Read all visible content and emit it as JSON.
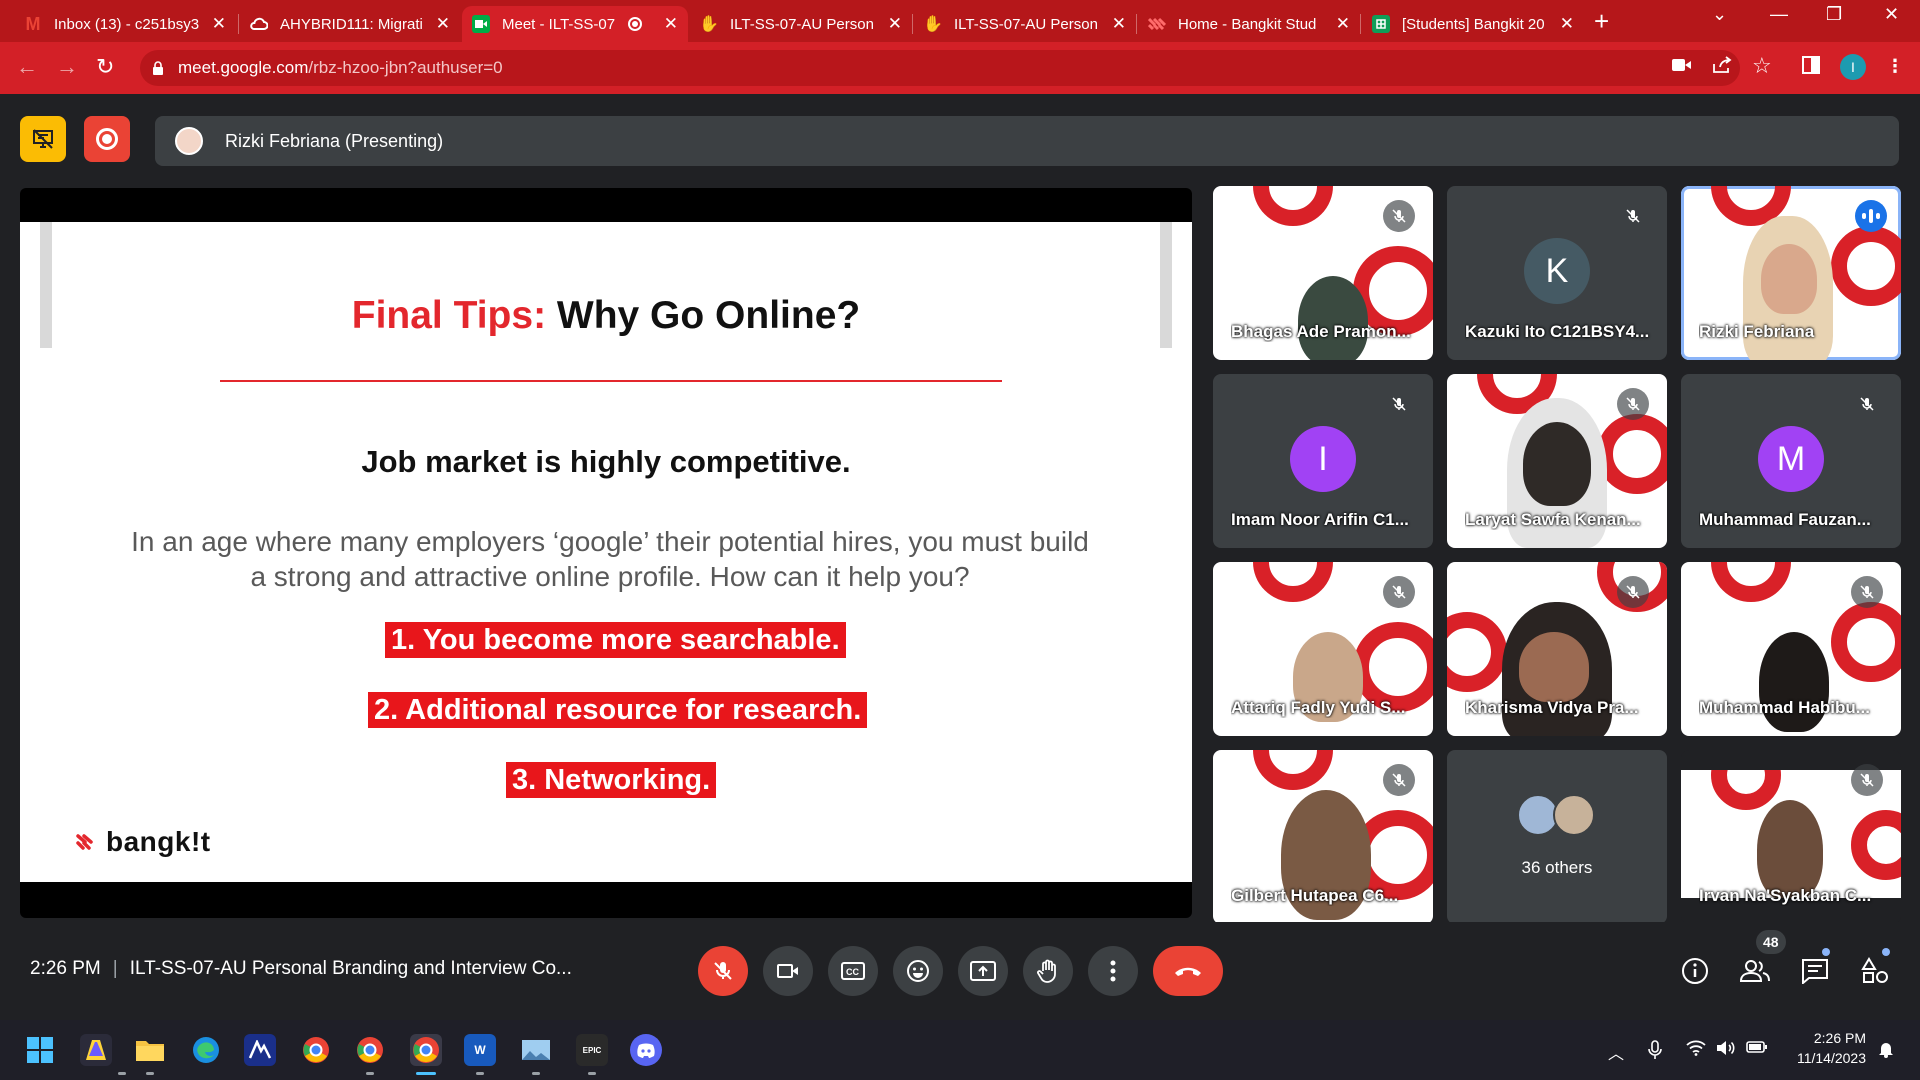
{
  "browser": {
    "tabs": [
      {
        "label": "Inbox (13) - c251bsy3",
        "icon": "gmail-icon",
        "color": "#ea4335"
      },
      {
        "label": "AHYBRID111: Migrati",
        "icon": "cloud-icon",
        "color": "#4285f4"
      },
      {
        "label": "Meet - ILT-SS-07",
        "icon": "meet-icon",
        "color": "#00ac47",
        "active": true
      },
      {
        "label": "ILT-SS-07-AU Person",
        "icon": "hand-icon",
        "color": "#fbbc04"
      },
      {
        "label": "ILT-SS-07-AU Person",
        "icon": "hand-icon",
        "color": "#fbbc04"
      },
      {
        "label": "Home - Bangkit Stud",
        "icon": "bangkit-icon",
        "color": "#d32027"
      },
      {
        "label": "[Students] Bangkit 20",
        "icon": "sheets-icon",
        "color": "#0f9d58"
      }
    ],
    "url_host": "meet.google.com",
    "url_path": "/rbz-hzoo-jbn?authuser=0",
    "profile_initial": "I"
  },
  "meeting": {
    "presenter_label": "Rizki Febriana (Presenting)",
    "time": "2:26 PM",
    "title": "ILT-SS-07-AU Personal Branding and Interview Co...",
    "participant_count": "48"
  },
  "slide": {
    "title_red": "Final Tips:",
    "title_black": " Why Go Online?",
    "subtitle": "Job market is highly competitive.",
    "body": "In an age where many employers ‘google’ their potential hires, you must build a strong and attractive online profile. How can it help you?",
    "items": [
      "1.   You become more searchable.",
      "2.   Additional resource for research.",
      "3.   Networking."
    ],
    "logo_text": "bangk!t"
  },
  "participants": [
    {
      "name": "Bhagas Ade Pramon...",
      "type": "video"
    },
    {
      "name": "Kazuki Ito C121BSY4...",
      "type": "avatar",
      "initial": "K",
      "color": "#455a64"
    },
    {
      "name": "Rizki Febriana",
      "type": "video",
      "speaking": true
    },
    {
      "name": "Imam Noor Arifin C1...",
      "type": "avatar",
      "initial": "I",
      "color": "#a142f4"
    },
    {
      "name": "Laryat Sawfa Kenan...",
      "type": "video"
    },
    {
      "name": "Muhammad Fauzan...",
      "type": "avatar",
      "initial": "M",
      "color": "#a142f4"
    },
    {
      "name": "Attariq Fadly Yudi S...",
      "type": "video"
    },
    {
      "name": "Kharisma Vidya Pra...",
      "type": "video"
    },
    {
      "name": "Muhammad Habibu...",
      "type": "video"
    },
    {
      "name": "Gilbert Hutapea C6...",
      "type": "video"
    },
    {
      "name": "36 others",
      "type": "others"
    },
    {
      "name": "Irvan Na'Syakban C...",
      "type": "video"
    }
  ],
  "taskbar": {
    "time": "2:26 PM",
    "date": "11/14/2023"
  }
}
